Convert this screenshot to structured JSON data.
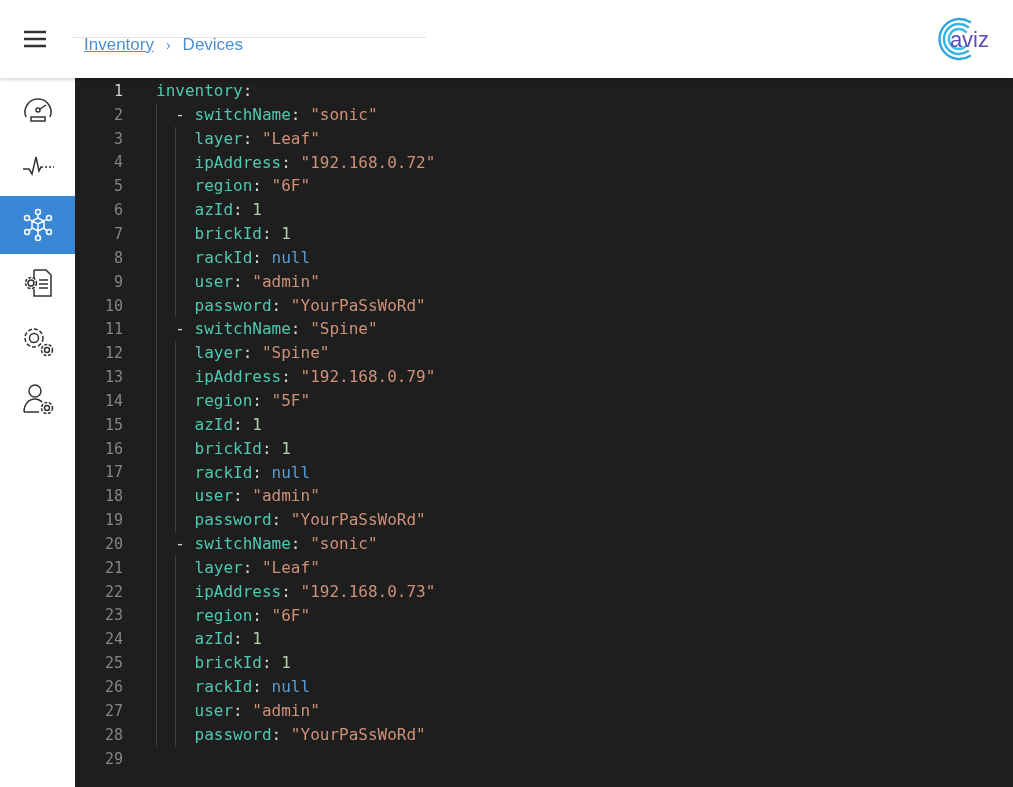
{
  "header": {
    "breadcrumb": [
      {
        "label": "Inventory",
        "kind": "link"
      },
      {
        "label": "›",
        "kind": "separator"
      },
      {
        "label": "Devices",
        "kind": "current"
      }
    ],
    "logo": "aviz"
  },
  "sidebar": {
    "items": [
      {
        "selected": false
      },
      {
        "selected": false
      },
      {
        "selected": true
      },
      {
        "selected": false
      },
      {
        "selected": false
      },
      {
        "selected": false
      }
    ]
  },
  "editor": {
    "lines": [
      {
        "number": "1",
        "current": true,
        "kind": "root",
        "tokens": [
          {
            "kind": "key",
            "text": "inventory"
          },
          {
            "kind": "punct",
            "text": ":"
          }
        ]
      },
      {
        "number": "2",
        "current": false,
        "kind": "item",
        "tokens": [
          {
            "kind": "punct",
            "text": "- "
          },
          {
            "kind": "key",
            "text": "switchName"
          },
          {
            "kind": "punct",
            "text": ": "
          },
          {
            "kind": "string",
            "text": "\"sonic\""
          }
        ]
      },
      {
        "number": "3",
        "current": false,
        "kind": "field",
        "tokens": [
          {
            "kind": "key",
            "text": "layer"
          },
          {
            "kind": "punct",
            "text": ": "
          },
          {
            "kind": "string",
            "text": "\"Leaf\""
          }
        ]
      },
      {
        "number": "4",
        "current": false,
        "kind": "field",
        "tokens": [
          {
            "kind": "key",
            "text": "ipAddress"
          },
          {
            "kind": "punct",
            "text": ": "
          },
          {
            "kind": "string",
            "text": "\"192.168.0.72\""
          }
        ]
      },
      {
        "number": "5",
        "current": false,
        "kind": "field",
        "tokens": [
          {
            "kind": "key",
            "text": "region"
          },
          {
            "kind": "punct",
            "text": ": "
          },
          {
            "kind": "string",
            "text": "\"6F\""
          }
        ]
      },
      {
        "number": "6",
        "current": false,
        "kind": "field",
        "tokens": [
          {
            "kind": "key",
            "text": "azId"
          },
          {
            "kind": "punct",
            "text": ": "
          },
          {
            "kind": "number",
            "text": "1"
          }
        ]
      },
      {
        "number": "7",
        "current": false,
        "kind": "field",
        "tokens": [
          {
            "kind": "key",
            "text": "brickId"
          },
          {
            "kind": "punct",
            "text": ": "
          },
          {
            "kind": "number",
            "text": "1"
          }
        ]
      },
      {
        "number": "8",
        "current": false,
        "kind": "field",
        "tokens": [
          {
            "kind": "key",
            "text": "rackId"
          },
          {
            "kind": "punct",
            "text": ": "
          },
          {
            "kind": "null",
            "text": "null"
          }
        ]
      },
      {
        "number": "9",
        "current": false,
        "kind": "field",
        "tokens": [
          {
            "kind": "key",
            "text": "user"
          },
          {
            "kind": "punct",
            "text": ": "
          },
          {
            "kind": "string",
            "text": "\"admin\""
          }
        ]
      },
      {
        "number": "10",
        "current": false,
        "kind": "field",
        "tokens": [
          {
            "kind": "key",
            "text": "password"
          },
          {
            "kind": "punct",
            "text": ": "
          },
          {
            "kind": "string",
            "text": "\"YourPaSsWoRd\""
          }
        ]
      },
      {
        "number": "11",
        "current": false,
        "kind": "item",
        "tokens": [
          {
            "kind": "punct",
            "text": "- "
          },
          {
            "kind": "key",
            "text": "switchName"
          },
          {
            "kind": "punct",
            "text": ": "
          },
          {
            "kind": "string",
            "text": "\"Spine\""
          }
        ]
      },
      {
        "number": "12",
        "current": false,
        "kind": "field",
        "tokens": [
          {
            "kind": "key",
            "text": "layer"
          },
          {
            "kind": "punct",
            "text": ": "
          },
          {
            "kind": "string",
            "text": "\"Spine\""
          }
        ]
      },
      {
        "number": "13",
        "current": false,
        "kind": "field",
        "tokens": [
          {
            "kind": "key",
            "text": "ipAddress"
          },
          {
            "kind": "punct",
            "text": ": "
          },
          {
            "kind": "string",
            "text": "\"192.168.0.79\""
          }
        ]
      },
      {
        "number": "14",
        "current": false,
        "kind": "field",
        "tokens": [
          {
            "kind": "key",
            "text": "region"
          },
          {
            "kind": "punct",
            "text": ": "
          },
          {
            "kind": "string",
            "text": "\"5F\""
          }
        ]
      },
      {
        "number": "15",
        "current": false,
        "kind": "field",
        "tokens": [
          {
            "kind": "key",
            "text": "azId"
          },
          {
            "kind": "punct",
            "text": ": "
          },
          {
            "kind": "number",
            "text": "1"
          }
        ]
      },
      {
        "number": "16",
        "current": false,
        "kind": "field",
        "tokens": [
          {
            "kind": "key",
            "text": "brickId"
          },
          {
            "kind": "punct",
            "text": ": "
          },
          {
            "kind": "number",
            "text": "1"
          }
        ]
      },
      {
        "number": "17",
        "current": false,
        "kind": "field",
        "tokens": [
          {
            "kind": "key",
            "text": "rackId"
          },
          {
            "kind": "punct",
            "text": ": "
          },
          {
            "kind": "null",
            "text": "null"
          }
        ]
      },
      {
        "number": "18",
        "current": false,
        "kind": "field",
        "tokens": [
          {
            "kind": "key",
            "text": "user"
          },
          {
            "kind": "punct",
            "text": ": "
          },
          {
            "kind": "string",
            "text": "\"admin\""
          }
        ]
      },
      {
        "number": "19",
        "current": false,
        "kind": "field",
        "tokens": [
          {
            "kind": "key",
            "text": "password"
          },
          {
            "kind": "punct",
            "text": ": "
          },
          {
            "kind": "string",
            "text": "\"YourPaSsWoRd\""
          }
        ]
      },
      {
        "number": "20",
        "current": false,
        "kind": "item",
        "tokens": [
          {
            "kind": "punct",
            "text": "- "
          },
          {
            "kind": "key",
            "text": "switchName"
          },
          {
            "kind": "punct",
            "text": ": "
          },
          {
            "kind": "string",
            "text": "\"sonic\""
          }
        ]
      },
      {
        "number": "21",
        "current": false,
        "kind": "field",
        "tokens": [
          {
            "kind": "key",
            "text": "layer"
          },
          {
            "kind": "punct",
            "text": ": "
          },
          {
            "kind": "string",
            "text": "\"Leaf\""
          }
        ]
      },
      {
        "number": "22",
        "current": false,
        "kind": "field",
        "tokens": [
          {
            "kind": "key",
            "text": "ipAddress"
          },
          {
            "kind": "punct",
            "text": ": "
          },
          {
            "kind": "string",
            "text": "\"192.168.0.73\""
          }
        ]
      },
      {
        "number": "23",
        "current": false,
        "kind": "field",
        "tokens": [
          {
            "kind": "key",
            "text": "region"
          },
          {
            "kind": "punct",
            "text": ": "
          },
          {
            "kind": "string",
            "text": "\"6F\""
          }
        ]
      },
      {
        "number": "24",
        "current": false,
        "kind": "field",
        "tokens": [
          {
            "kind": "key",
            "text": "azId"
          },
          {
            "kind": "punct",
            "text": ": "
          },
          {
            "kind": "number",
            "text": "1"
          }
        ]
      },
      {
        "number": "25",
        "current": false,
        "kind": "field",
        "tokens": [
          {
            "kind": "key",
            "text": "brickId"
          },
          {
            "kind": "punct",
            "text": ": "
          },
          {
            "kind": "number",
            "text": "1"
          }
        ]
      },
      {
        "number": "26",
        "current": false,
        "kind": "field",
        "tokens": [
          {
            "kind": "key",
            "text": "rackId"
          },
          {
            "kind": "punct",
            "text": ": "
          },
          {
            "kind": "null",
            "text": "null"
          }
        ]
      },
      {
        "number": "27",
        "current": false,
        "kind": "field",
        "tokens": [
          {
            "kind": "key",
            "text": "user"
          },
          {
            "kind": "punct",
            "text": ": "
          },
          {
            "kind": "string",
            "text": "\"admin\""
          }
        ]
      },
      {
        "number": "28",
        "current": false,
        "kind": "field",
        "tokens": [
          {
            "kind": "key",
            "text": "password"
          },
          {
            "kind": "punct",
            "text": ": "
          },
          {
            "kind": "string",
            "text": "\"YourPaSsWoRd\""
          }
        ]
      },
      {
        "number": "29",
        "current": false,
        "kind": "blank"
      }
    ]
  }
}
